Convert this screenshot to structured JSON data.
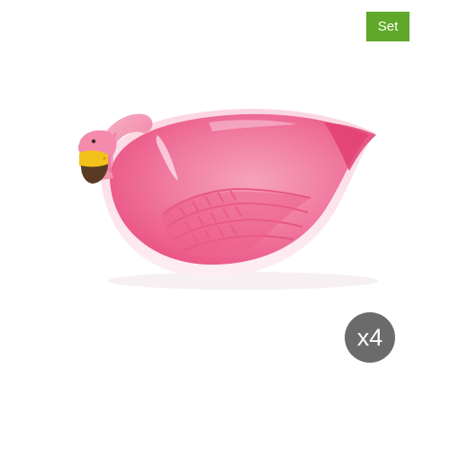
{
  "badges": {
    "set_label": "Set",
    "quantity_label": "x4"
  },
  "colors": {
    "set_badge": "#5fa82a",
    "quantity_badge": "#6b6b6b",
    "bowl_pink": "#ef6f96",
    "bowl_rim": "#fbe3ea",
    "beak_yellow": "#f2c21b",
    "beak_brown": "#5a3a24"
  },
  "image": {
    "subject": "flamingo-shaped-bowl"
  }
}
